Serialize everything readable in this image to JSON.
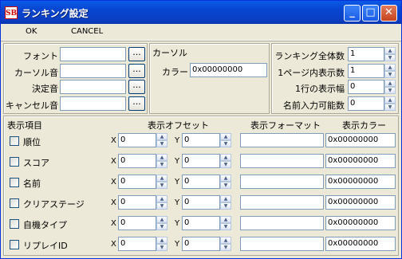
{
  "window": {
    "title": "ランキング設定",
    "icon_label": "SB",
    "controls": {
      "minimize": "_",
      "maximize": "□",
      "close": "✕"
    }
  },
  "menu": {
    "ok": "OK",
    "cancel": "CANCEL"
  },
  "sound_panel": {
    "rows": [
      {
        "label": "フォント",
        "value": "",
        "button": "..."
      },
      {
        "label": "カーソル音",
        "value": "",
        "button": "..."
      },
      {
        "label": "決定音",
        "value": "",
        "button": "..."
      },
      {
        "label": "キャンセル音",
        "value": "",
        "button": "..."
      }
    ]
  },
  "cursor_panel": {
    "title": "カーソル",
    "color_label": "カラー",
    "color_value": "0x00000000"
  },
  "ranking_panel": {
    "rows": [
      {
        "label": "ランキング全体数",
        "value": "1"
      },
      {
        "label": "1ページ内表示数",
        "value": "1"
      },
      {
        "label": "1行の表示幅",
        "value": "0"
      },
      {
        "label": "名前入力可能数",
        "value": "0"
      }
    ]
  },
  "display": {
    "headers": {
      "item": "表示項目",
      "offset": "表示オフセット",
      "format": "表示フォーマット",
      "color": "表示カラー"
    },
    "x_label": "X",
    "y_label": "Y",
    "rows": [
      {
        "name": "順位",
        "checked": false,
        "x": "0",
        "y": "0",
        "format": "",
        "color": "0x00000000"
      },
      {
        "name": "スコア",
        "checked": false,
        "x": "0",
        "y": "0",
        "format": "",
        "color": "0x00000000"
      },
      {
        "name": "名前",
        "checked": false,
        "x": "0",
        "y": "0",
        "format": "",
        "color": "0x00000000"
      },
      {
        "name": "クリアステージ",
        "checked": false,
        "x": "0",
        "y": "0",
        "format": "",
        "color": "0x00000000"
      },
      {
        "name": "自機タイプ",
        "checked": false,
        "x": "0",
        "y": "0",
        "format": "",
        "color": "0x00000000"
      },
      {
        "name": "リプレイID",
        "checked": false,
        "x": "0",
        "y": "0",
        "format": "",
        "color": "0x00000000"
      }
    ]
  }
}
